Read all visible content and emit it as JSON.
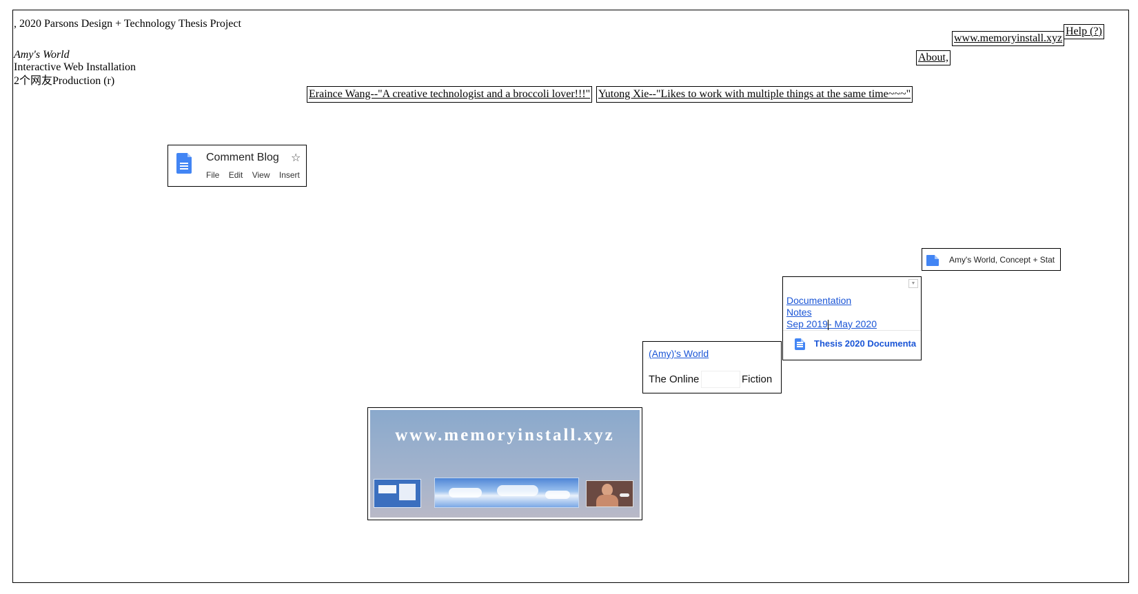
{
  "header": {
    "project": ", 2020 Parsons Design + Technology Thesis Project",
    "title": "Amy's World",
    "subtitle": "Interactive Web Installation",
    "production": "2个网友Production (r)"
  },
  "nav": {
    "site_link": "www.memoryinstall.xyz",
    "help_link": "Help (?)",
    "about_link": "About,"
  },
  "credits": {
    "person1": "Eraince Wang--\"A creative technologist and a broccoli lover!!!\"",
    "person2": "Yutong Xie--\"Likes to work with multiple things at the same time~~~\""
  },
  "comment_blog": {
    "title": "Comment Blog",
    "star": "☆",
    "menu": [
      "File",
      "Edit",
      "View",
      "Insert"
    ]
  },
  "concept_doc": {
    "label": "Amy's World, Concept + Stat"
  },
  "docs_panel": {
    "link1": "Documentation",
    "link2": "Notes",
    "link3_a": "Sep 2019",
    "link3_b": "- May 2020",
    "doc_title": "Thesis 2020 Documenta"
  },
  "fiction_card": {
    "link": "(Amy)'s World",
    "text_a": "The Online",
    "text_b": "Fiction"
  },
  "preview": {
    "heading": "www.memoryinstall.xyz"
  },
  "colors": {
    "link_blue": "#1a55d6",
    "docs_blue": "#4285f4",
    "sky_top": "#8aa9cc",
    "sky_bottom": "#b9b9c7"
  }
}
